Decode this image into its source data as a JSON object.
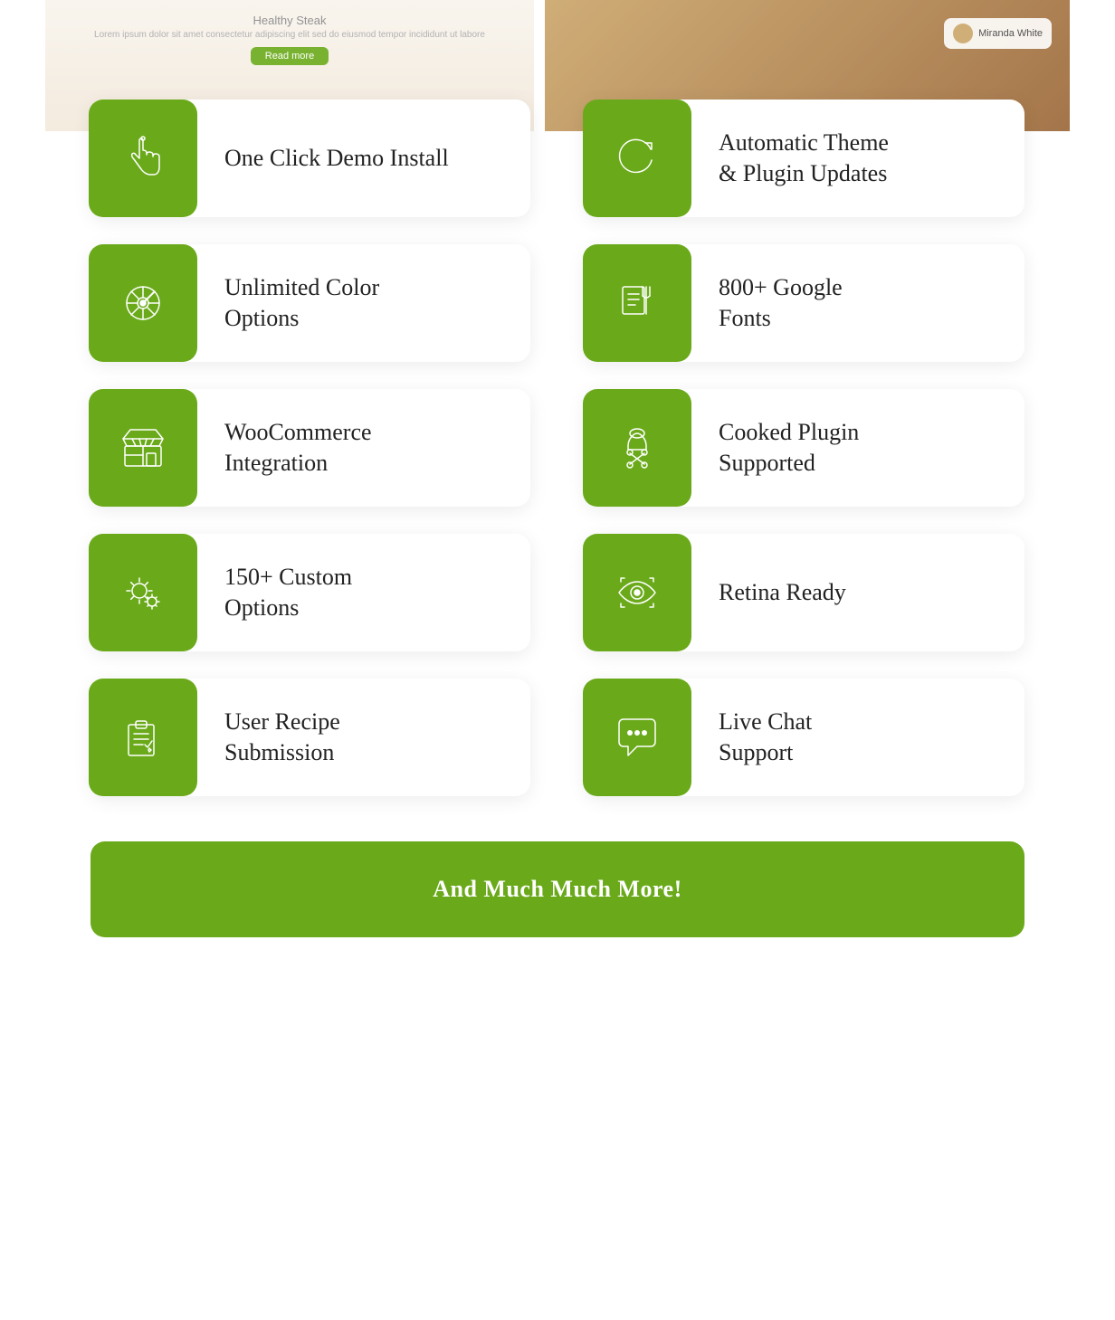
{
  "colors": {
    "green": "#6aaa1a",
    "white": "#ffffff",
    "text_dark": "#222222"
  },
  "features": [
    {
      "id": "one-click-demo",
      "label": "One Click\nDemo Install",
      "icon": "hand-pointer"
    },
    {
      "id": "automatic-updates",
      "label": "Automatic Theme\n& Plugin Updates",
      "icon": "refresh"
    },
    {
      "id": "unlimited-color",
      "label": "Unlimited Color\nOptions",
      "icon": "color-wheel"
    },
    {
      "id": "google-fonts",
      "label": "800+ Google\nFonts",
      "icon": "fonts"
    },
    {
      "id": "woocommerce",
      "label": "WooCommerce\nIntegration",
      "icon": "store"
    },
    {
      "id": "cooked-plugin",
      "label": "Cooked Plugin\nSupported",
      "icon": "chef"
    },
    {
      "id": "custom-options",
      "label": "150+ Custom\nOptions",
      "icon": "settings"
    },
    {
      "id": "retina-ready",
      "label": "Retina Ready",
      "icon": "eye"
    },
    {
      "id": "user-recipe",
      "label": "User Recipe\nSubmission",
      "icon": "recipe"
    },
    {
      "id": "live-chat",
      "label": "Live Chat\nSupport",
      "icon": "chat"
    }
  ],
  "more_button": {
    "label": "And Much Much More!"
  }
}
